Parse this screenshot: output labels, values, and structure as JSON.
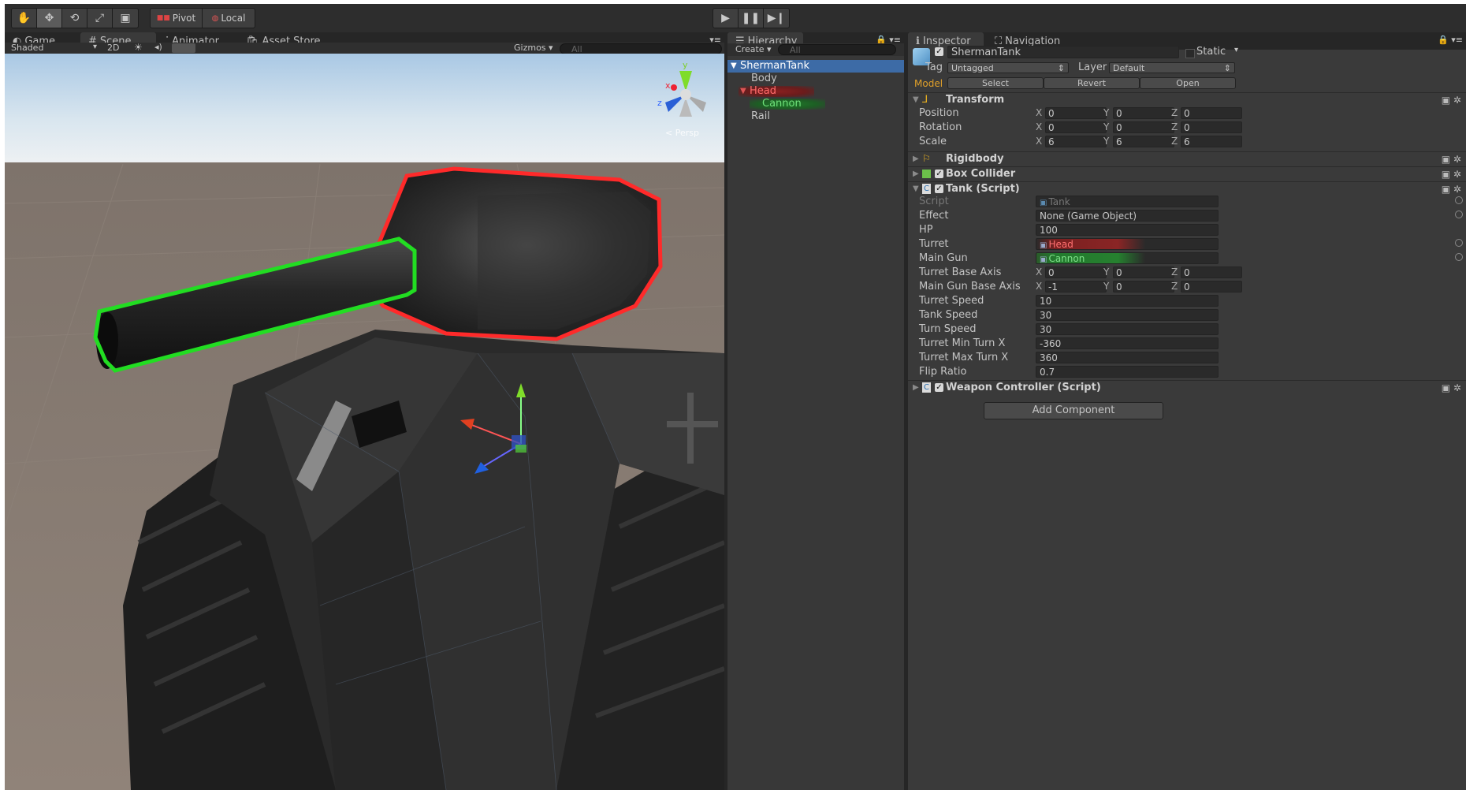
{
  "toolbar": {
    "tools": [
      "hand-icon",
      "move-icon",
      "rotate-icon",
      "scale-icon",
      "rect-icon"
    ],
    "pivot_label": "Pivot",
    "local_label": "Local",
    "play_controls": [
      "play-icon",
      "pause-icon",
      "step-icon"
    ]
  },
  "scene_panel": {
    "tabs": [
      "Game",
      "Scene",
      "Animator",
      "Asset Store"
    ],
    "selected_tab": "Scene",
    "shading_mode": "Shaded",
    "mode_2d_label": "2D",
    "gizmos_label": "Gizmos",
    "search_placeholder": "All",
    "persp_label": "< Persp",
    "gizmo_axes": {
      "y": "y",
      "x": "x",
      "z": "z"
    }
  },
  "hierarchy": {
    "tab_label": "Hierarchy",
    "create_label": "Create",
    "search_placeholder": "All",
    "items": [
      "ShermanTank",
      "Body",
      "Head",
      "Cannon",
      "Rail"
    ]
  },
  "inspector": {
    "tabs": [
      "Inspector",
      "Navigation"
    ],
    "object_name": "ShermanTank",
    "static_label": "Static",
    "tag_label": "Tag",
    "tag_value": "Untagged",
    "layer_label": "Layer",
    "layer_value": "Default",
    "model_label": "Model",
    "model_buttons": [
      "Select",
      "Revert",
      "Open"
    ],
    "transform": {
      "title": "Transform",
      "rows": [
        {
          "label": "Position",
          "x": "0",
          "y": "0",
          "z": "0"
        },
        {
          "label": "Rotation",
          "x": "0",
          "y": "0",
          "z": "0"
        },
        {
          "label": "Scale",
          "x": "6",
          "y": "6",
          "z": "6"
        }
      ]
    },
    "components": {
      "rigidbody": "Rigidbody",
      "box_collider": "Box Collider",
      "tank_script": "Tank (Script)",
      "weapon_controller": "Weapon Controller (Script)"
    },
    "tank_fields": {
      "script": {
        "label": "Script",
        "value": "Tank"
      },
      "effect": {
        "label": "Effect",
        "value": "None (Game Object)"
      },
      "hp": {
        "label": "HP",
        "value": "100"
      },
      "turret": {
        "label": "Turret",
        "value": "Head"
      },
      "main_gun": {
        "label": "Main Gun",
        "value": "Cannon"
      },
      "turret_base_axis": {
        "label": "Turret Base Axis",
        "x": "0",
        "y": "0",
        "z": "0"
      },
      "main_gun_base_axis": {
        "label": "Main Gun Base Axis",
        "x": "-1",
        "y": "0",
        "z": "0"
      },
      "turret_speed": {
        "label": "Turret Speed",
        "value": "10"
      },
      "tank_speed": {
        "label": "Tank Speed",
        "value": "30"
      },
      "turn_speed": {
        "label": "Turn Speed",
        "value": "30"
      },
      "turret_min_turn_x": {
        "label": "Turret Min Turn X",
        "value": "-360"
      },
      "turret_max_turn_x": {
        "label": "Turret Max Turn X",
        "value": "360"
      },
      "flip_ratio": {
        "label": "Flip Ratio",
        "value": "0.7"
      }
    },
    "axis_letters": {
      "x": "X",
      "y": "Y",
      "z": "Z"
    },
    "add_component_label": "Add Component"
  },
  "colors": {
    "selection_blue": "#3d6ba6",
    "turret_outline": "#ff2a2a",
    "cannon_outline": "#22dd22",
    "highlight_red": "#8a2020",
    "highlight_green": "#1f7a2a"
  }
}
